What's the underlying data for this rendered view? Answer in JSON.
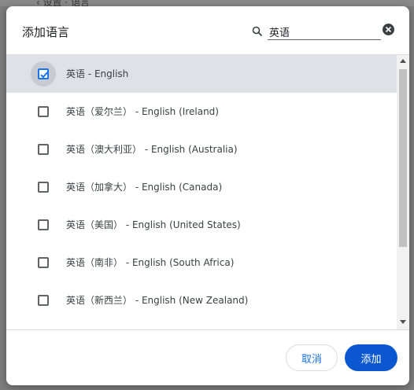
{
  "background": {
    "partial_text": "‹ 设置 · 语言"
  },
  "dialog": {
    "title": "添加语言",
    "search": {
      "value": "英语",
      "icon": "search-icon",
      "clear_icon": "close-icon"
    },
    "languages": [
      {
        "label": "英语 - English",
        "checked": true
      },
      {
        "label": "英语（爱尔兰） - English (Ireland)",
        "checked": false
      },
      {
        "label": "英语（澳大利亚） - English (Australia)",
        "checked": false
      },
      {
        "label": "英语（加拿大） - English (Canada)",
        "checked": false
      },
      {
        "label": "英语（美国） - English (United States)",
        "checked": false
      },
      {
        "label": "英语（南非） - English (South Africa)",
        "checked": false
      },
      {
        "label": "英语（新西兰） - English (New Zealand)",
        "checked": false
      }
    ],
    "buttons": {
      "cancel": "取消",
      "add": "添加"
    }
  },
  "colors": {
    "accent": "#1a73e8",
    "primary_button": "#0b57d0",
    "selected_row": "#dee1e6"
  }
}
